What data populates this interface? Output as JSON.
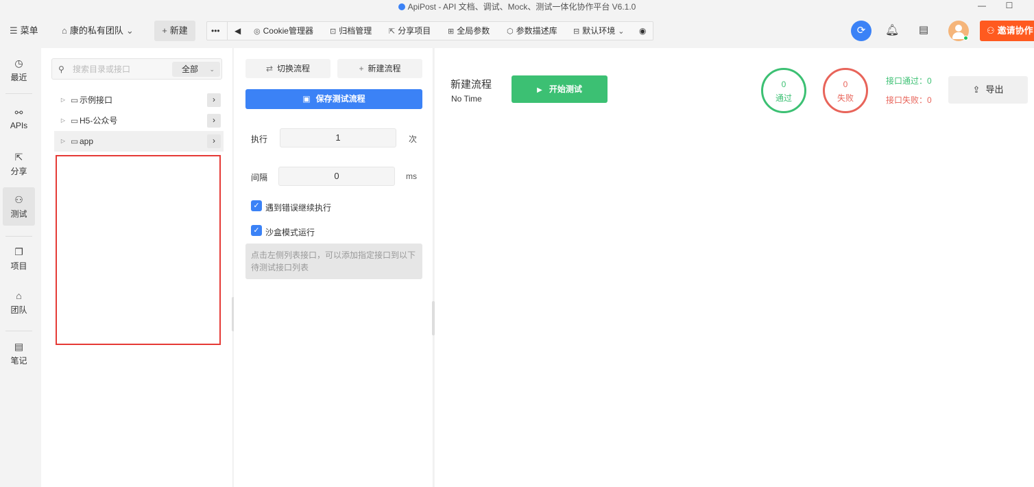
{
  "window": {
    "title": "ApiPost - API 文档、调试、Mock、测试一体化协作平台 V6.1.0",
    "minimize_icon": "minimize-icon",
    "maximize_icon": "maximize-icon"
  },
  "toolbar": {
    "menu_label": "菜单",
    "team_label": "康的私有团队",
    "new_label": "新建",
    "more_icon": "more-dots-icon",
    "collapse_icon": "triangle-left-icon",
    "items": [
      {
        "label": "Cookie管理器",
        "icon": "cookie-icon"
      },
      {
        "label": "归档管理",
        "icon": "archive-icon"
      },
      {
        "label": "分享项目",
        "icon": "share-icon"
      },
      {
        "label": "全局参数",
        "icon": "params-icon"
      },
      {
        "label": "参数描述库",
        "icon": "cube-icon"
      },
      {
        "label": "默认环境",
        "icon": "env-icon"
      }
    ],
    "invite_label": "邀请协作"
  },
  "rail": {
    "items": [
      {
        "label": "最近",
        "icon": "history-icon"
      },
      {
        "label": "APIs",
        "icon": "api-icon"
      },
      {
        "label": "分享",
        "icon": "share-icon"
      },
      {
        "label": "测试",
        "icon": "test-icon",
        "active": true
      },
      {
        "label": "项目",
        "icon": "project-icon"
      },
      {
        "label": "团队",
        "icon": "team-icon"
      },
      {
        "label": "笔记",
        "icon": "note-icon"
      }
    ]
  },
  "tree": {
    "search_placeholder": "搜索目录或接口",
    "scope": "全部",
    "items": [
      {
        "name": "示例接口"
      },
      {
        "name": "H5-公众号"
      },
      {
        "name": "app",
        "selected": true
      }
    ]
  },
  "flow_config": {
    "switch_label": "切换流程",
    "new_flow_label": "新建流程",
    "save_label": "保存测试流程",
    "exec_label": "执行",
    "exec_value": "1",
    "exec_unit": "次",
    "interval_label": "间隔",
    "interval_value": "0",
    "interval_unit": "ms",
    "continue_on_error_label": "遇到错误继续执行",
    "continue_on_error": true,
    "sandbox_label": "沙盒模式运行",
    "sandbox": true,
    "hint": "点击左侧列表接口，可以添加指定接口到以下待测试接口列表"
  },
  "main": {
    "flow_name": "新建流程",
    "flow_time": "No Time",
    "start_label": "开始测试",
    "pass_count": "0",
    "pass_label": "通过",
    "fail_count": "0",
    "fail_label": "失败",
    "api_pass": "接口通过：0",
    "api_fail": "接口失败：0",
    "export_label": "导出"
  },
  "colors": {
    "primary": "#3b82f6",
    "success": "#3cc073",
    "danger": "#e8645a",
    "invite": "#ff5a1f",
    "highlight_box": "#e53935"
  }
}
